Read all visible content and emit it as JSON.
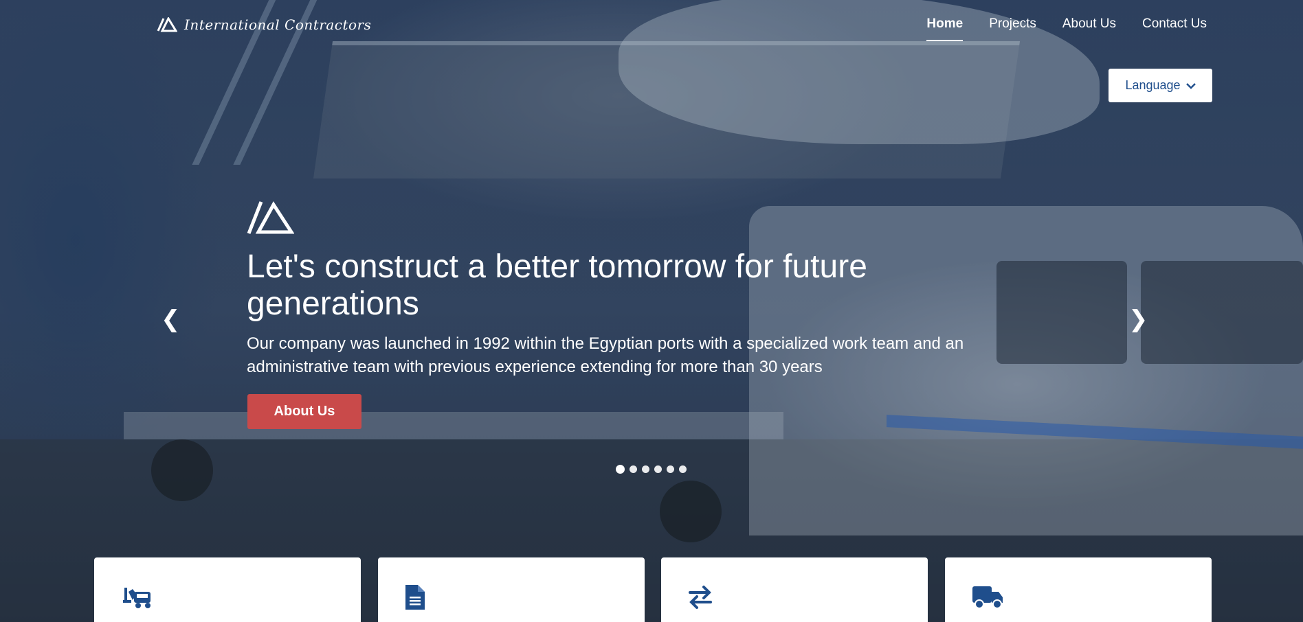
{
  "header": {
    "logo_text": "International Contractors",
    "nav": [
      {
        "label": "Home",
        "active": true
      },
      {
        "label": "Projects",
        "active": false
      },
      {
        "label": "About Us",
        "active": false
      },
      {
        "label": "Contact Us",
        "active": false
      }
    ],
    "language_label": "Language"
  },
  "hero": {
    "headline": "Let's construct a better tomorrow for future generations",
    "subtext": "Our company was launched in 1992 within the Egyptian ports with a specialized work team and an administrative team with previous experience extending for more than 30 years",
    "cta_label": "About Us",
    "prev_arrow": "❮",
    "next_arrow": "❯",
    "slide_count": 6,
    "active_slide": 1
  },
  "services": [
    {
      "icon": "forklift-truck-icon"
    },
    {
      "icon": "document-icon"
    },
    {
      "icon": "exchange-arrows-icon"
    },
    {
      "icon": "delivery-truck-icon"
    }
  ],
  "colors": {
    "accent": "#c94a4a",
    "brand_blue": "#1f4e8c",
    "overlay": "#1e304e"
  }
}
